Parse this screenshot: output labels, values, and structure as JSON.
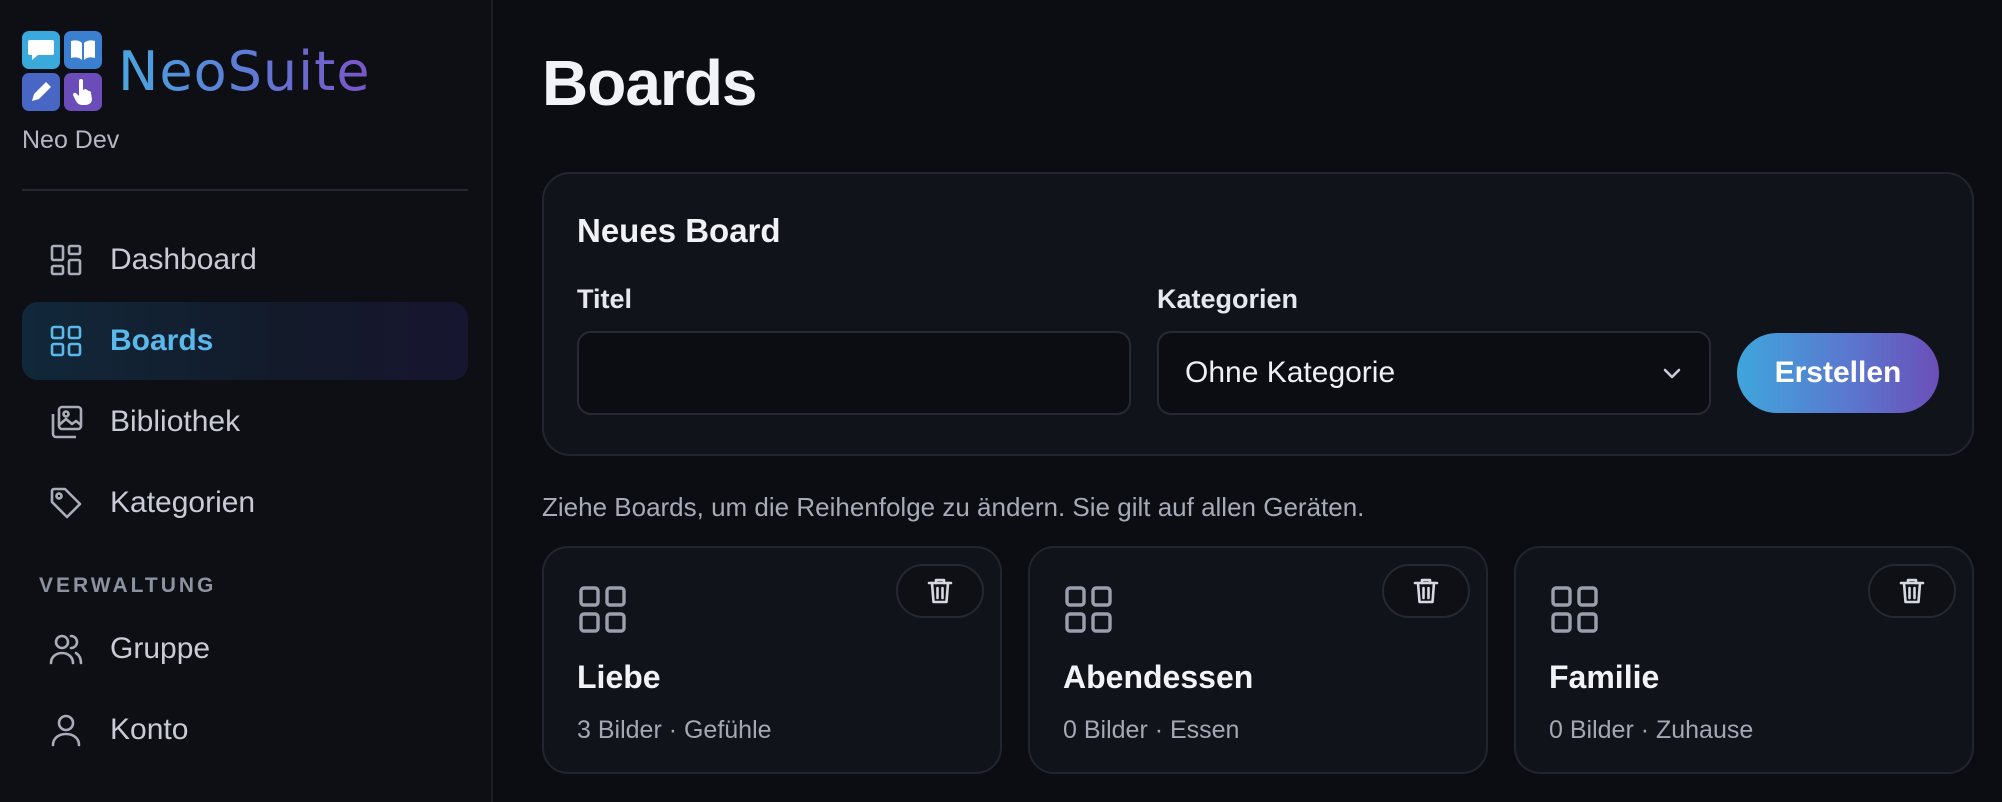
{
  "brand": {
    "name": "NeoSuite",
    "user": "Neo Dev"
  },
  "sidebar": {
    "items": [
      {
        "label": "Dashboard",
        "icon": "dashboard-icon",
        "active": false
      },
      {
        "label": "Boards",
        "icon": "grid-icon",
        "active": true
      },
      {
        "label": "Bibliothek",
        "icon": "image-library-icon",
        "active": false
      },
      {
        "label": "Kategorien",
        "icon": "tag-icon",
        "active": false
      }
    ],
    "section_label": "VERWALTUNG",
    "admin_items": [
      {
        "label": "Gruppe",
        "icon": "users-icon"
      },
      {
        "label": "Konto",
        "icon": "user-icon"
      }
    ]
  },
  "main": {
    "title": "Boards",
    "new_board": {
      "title": "Neues Board",
      "title_label": "Titel",
      "title_value": "",
      "category_label": "Kategorien",
      "category_value": "Ohne Kategorie",
      "create_label": "Erstellen"
    },
    "hint": "Ziehe Boards, um die Reihenfolge zu ändern. Sie gilt auf allen Geräten.",
    "boards": [
      {
        "title": "Liebe",
        "meta": "3 Bilder · Gefühle"
      },
      {
        "title": "Abendessen",
        "meta": "0 Bilder · Essen"
      },
      {
        "title": "Familie",
        "meta": "0 Bilder · Zuhause"
      }
    ]
  },
  "colors": {
    "background": "#0b0d13",
    "accent": "#5bb8ea",
    "brand_gradient_start": "#3fa6dc",
    "brand_gradient_end": "#6b4fb8"
  }
}
